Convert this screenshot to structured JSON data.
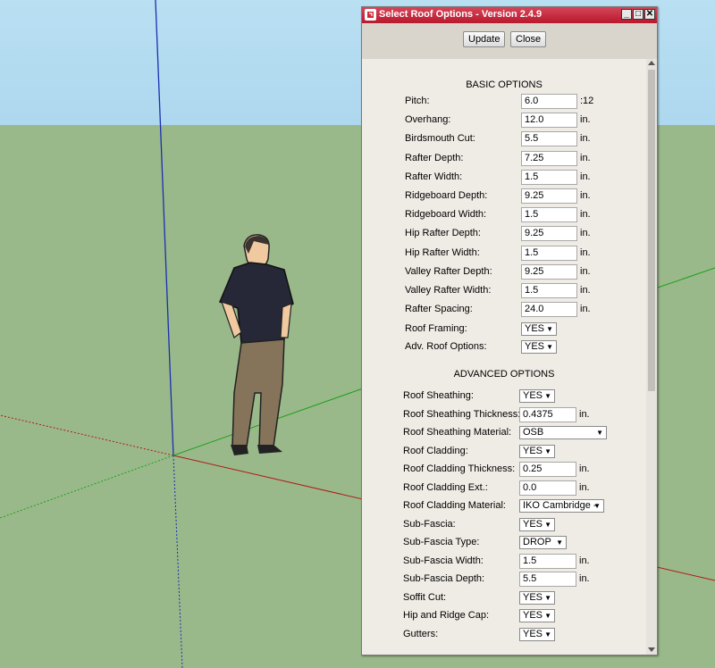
{
  "window": {
    "title": "Select Roof Options - Version 2.4.9",
    "minimize_glyph": "_",
    "maximize_glyph": "□",
    "close_glyph": "✕"
  },
  "toolbar": {
    "update_label": "Update",
    "close_label": "Close"
  },
  "basic": {
    "heading": "BASIC OPTIONS",
    "fields": [
      {
        "label": "Pitch:",
        "value": "6.0",
        "unit": ":12"
      },
      {
        "label": "Overhang:",
        "value": "12.0",
        "unit": "in."
      },
      {
        "label": "Birdsmouth Cut:",
        "value": "5.5",
        "unit": "in."
      },
      {
        "label": "Rafter Depth:",
        "value": "7.25",
        "unit": "in."
      },
      {
        "label": "Rafter Width:",
        "value": "1.5",
        "unit": "in."
      },
      {
        "label": "Ridgeboard Depth:",
        "value": "9.25",
        "unit": "in."
      },
      {
        "label": "Ridgeboard Width:",
        "value": "1.5",
        "unit": "in."
      },
      {
        "label": "Hip Rafter Depth:",
        "value": "9.25",
        "unit": "in."
      },
      {
        "label": "Hip Rafter Width:",
        "value": "1.5",
        "unit": "in."
      },
      {
        "label": "Valley Rafter Depth:",
        "value": "9.25",
        "unit": "in."
      },
      {
        "label": "Valley Rafter Width:",
        "value": "1.5",
        "unit": "in."
      },
      {
        "label": "Rafter Spacing:",
        "value": "24.0",
        "unit": "in."
      }
    ],
    "selects": [
      {
        "label": "Roof Framing:",
        "value": "YES"
      },
      {
        "label": "Adv. Roof Options:",
        "value": "YES"
      }
    ]
  },
  "advanced": {
    "heading": "ADVANCED OPTIONS",
    "rows": [
      {
        "type": "select",
        "label": "Roof Sheathing:",
        "value": "YES"
      },
      {
        "type": "input",
        "label": "Roof Sheathing Thickness:",
        "value": "0.4375",
        "unit": "in."
      },
      {
        "type": "select-wide",
        "label": "Roof Sheathing Material:",
        "value": "OSB"
      },
      {
        "type": "select",
        "label": "Roof Cladding:",
        "value": "YES"
      },
      {
        "type": "input",
        "label": "Roof Cladding Thickness:",
        "value": "0.25",
        "unit": "in."
      },
      {
        "type": "input",
        "label": "Roof Cladding Ext.:",
        "value": "0.0",
        "unit": "in."
      },
      {
        "type": "select-med",
        "label": "Roof Cladding Material:",
        "value": "IKO Cambridge -"
      },
      {
        "type": "select",
        "label": "Sub-Fascia:",
        "value": "YES"
      },
      {
        "type": "select-drop",
        "label": "Sub-Fascia Type:",
        "value": "DROP"
      },
      {
        "type": "input",
        "label": "Sub-Fascia Width:",
        "value": "1.5",
        "unit": "in."
      },
      {
        "type": "input",
        "label": "Sub-Fascia Depth:",
        "value": "5.5",
        "unit": "in."
      },
      {
        "type": "select",
        "label": "Soffit Cut:",
        "value": "YES"
      },
      {
        "type": "select",
        "label": "Hip and Ridge Cap:",
        "value": "YES"
      },
      {
        "type": "select",
        "label": "Gutters:",
        "value": "YES"
      }
    ]
  },
  "colors": {
    "titlebar": "#c0253a",
    "dialog_bg": "#efebe5",
    "sky": "#b3dbf0",
    "ground": "#9ab98a",
    "axis_blue": "#1a2fb0",
    "axis_red": "#b01a1a",
    "axis_green": "#1aa01a"
  },
  "icons": {
    "app": "sketchup-ruby-icon",
    "dropdown": "caret-down-icon"
  }
}
